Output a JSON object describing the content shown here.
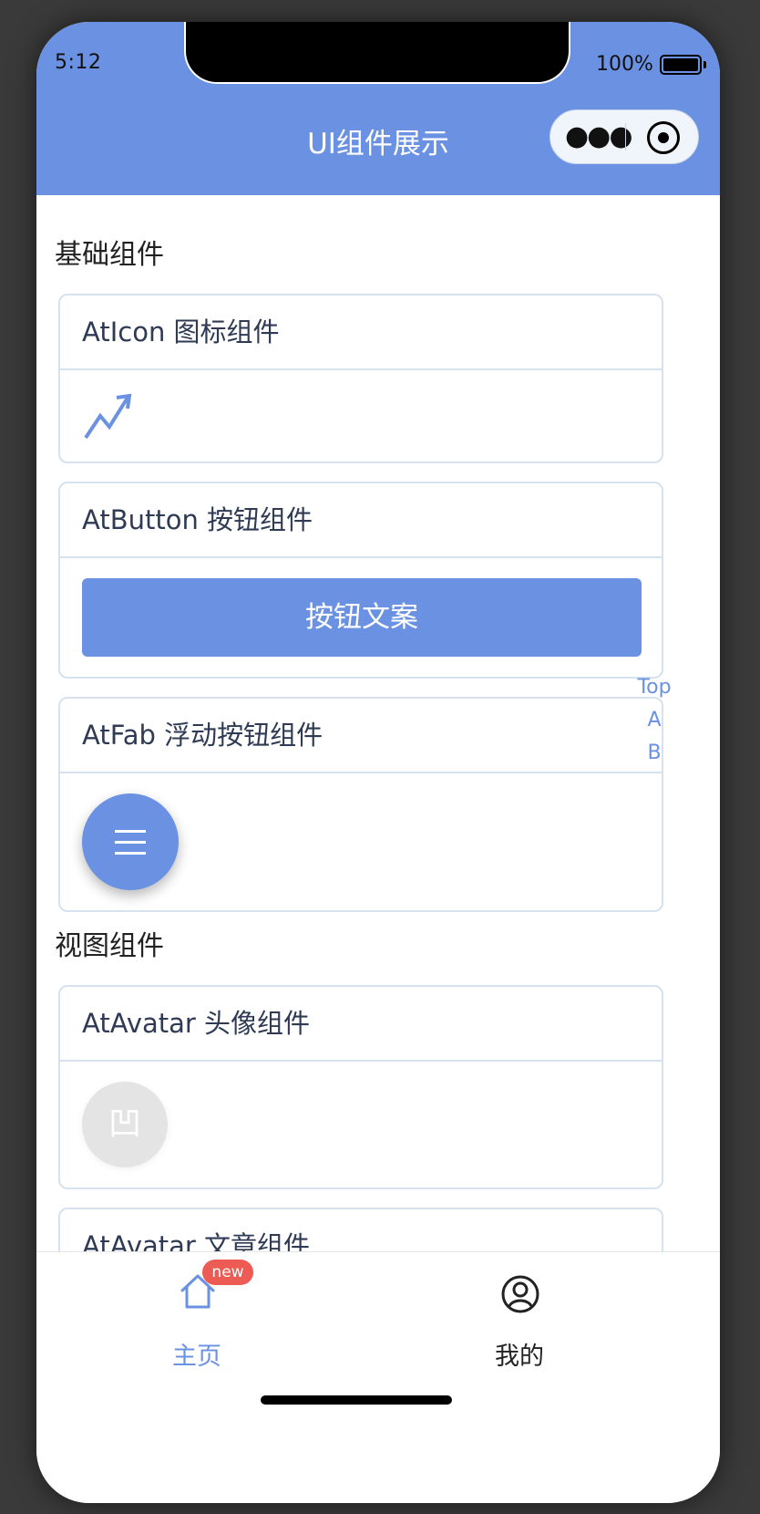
{
  "status_bar": {
    "time": "5:12",
    "battery": "100%"
  },
  "nav": {
    "title": "UI组件展示",
    "menu_icon": "more-dots-icon",
    "close_icon": "target-icon"
  },
  "sections": [
    {
      "title": "基础组件"
    },
    {
      "title": "视图组件"
    }
  ],
  "cards": {
    "icon": {
      "title": "AtIcon 图标组件",
      "icon": "trending-up-icon"
    },
    "button": {
      "title": "AtButton 按钮组件",
      "button_label": "按钮文案"
    },
    "fab": {
      "title": "AtFab 浮动按钮组件",
      "icon": "menu-icon"
    },
    "avatar": {
      "title": "AtAvatar 头像组件",
      "avatar_text": "凹"
    },
    "article": {
      "title": "AtAvatar 文章组件"
    }
  },
  "anchors": [
    "Top",
    "A",
    "B"
  ],
  "tabbar": {
    "items": [
      {
        "label": "主页",
        "icon": "home-icon",
        "badge": "new",
        "active": true
      },
      {
        "label": "我的",
        "icon": "user-icon",
        "active": false
      }
    ]
  },
  "colors": {
    "accent": "#6b91e3",
    "badge": "#ec5c55",
    "border": "#d6e2f0"
  }
}
